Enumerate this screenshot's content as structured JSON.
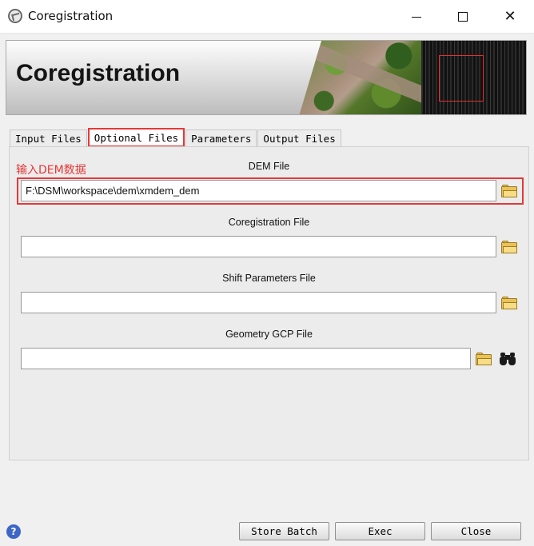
{
  "window": {
    "title": "Coregistration"
  },
  "banner": {
    "title": "Coregistration"
  },
  "tabs": [
    {
      "label": "Input Files",
      "active": false
    },
    {
      "label": "Optional Files",
      "active": true
    },
    {
      "label": "Parameters",
      "active": false
    },
    {
      "label": "Output Files",
      "active": false
    }
  ],
  "annotation": "输入DEM数据",
  "fields": {
    "dem": {
      "label": "DEM File",
      "value": "F:\\DSM\\workspace\\dem\\xmdem_dem"
    },
    "coregistration": {
      "label": "Coregistration File",
      "value": ""
    },
    "shift": {
      "label": "Shift Parameters File",
      "value": ""
    },
    "geometry_gcp": {
      "label": "Geometry GCP File",
      "value": ""
    }
  },
  "buttons": {
    "store_batch": "Store Batch",
    "exec": "Exec",
    "close": "Close"
  },
  "help": "?",
  "colors": {
    "highlight": "#e43838",
    "help_icon": "#3d66c7"
  }
}
